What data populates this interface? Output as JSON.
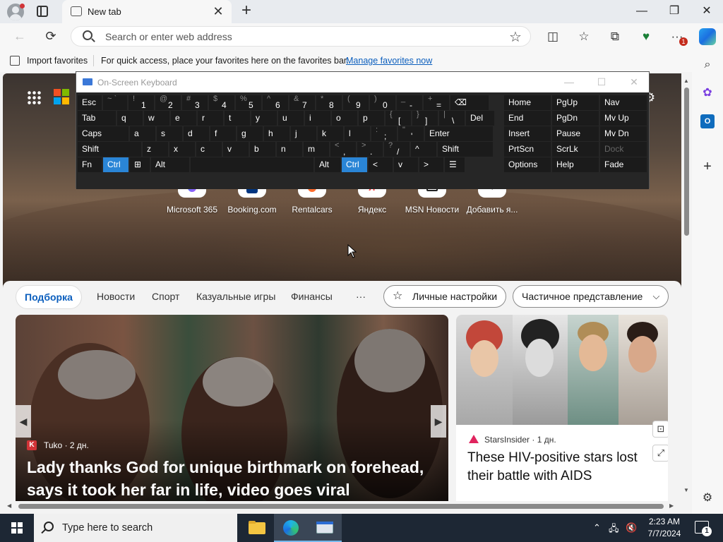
{
  "browser": {
    "tab_title": "New tab",
    "tab_close": "✕",
    "new_tab": "+",
    "window_minimize": "—",
    "window_restore": "❐",
    "window_close": "✕",
    "address_placeholder": "Search or enter web address",
    "nav_back": "←",
    "nav_refresh": "⟳",
    "fav_star": "☆",
    "notifications_badge": "1"
  },
  "favorites_bar": {
    "import_label": "Import favorites",
    "message": "For quick access, place your favorites here on the favorites bar.",
    "link": "Manage favorites now"
  },
  "sidebar_icons": [
    "search-icon",
    "copilot-icon",
    "outlook-icon",
    "add-icon",
    "settings-icon"
  ],
  "osk": {
    "title": "On-Screen Keyboard",
    "win_minimize": "—",
    "win_restore": "☐",
    "win_close": "✕",
    "rows": [
      [
        {
          "l": "Esc"
        },
        {
          "s": "~ `",
          "m": ""
        },
        {
          "s": "!",
          "m": "1"
        },
        {
          "s": "@",
          "m": "2"
        },
        {
          "s": "#",
          "m": "3"
        },
        {
          "s": "$",
          "m": "4"
        },
        {
          "s": "%",
          "m": "5"
        },
        {
          "s": "^",
          "m": "6"
        },
        {
          "s": "&",
          "m": "7"
        },
        {
          "s": "*",
          "m": "8"
        },
        {
          "s": "(",
          "m": "9"
        },
        {
          "s": ")",
          "m": "0"
        },
        {
          "s": "_",
          "m": "-"
        },
        {
          "s": "+",
          "m": "="
        },
        {
          "l": "⌫"
        }
      ],
      [
        {
          "l": "Tab"
        },
        {
          "l": "q"
        },
        {
          "l": "w"
        },
        {
          "l": "e"
        },
        {
          "l": "r"
        },
        {
          "l": "t"
        },
        {
          "l": "y"
        },
        {
          "l": "u"
        },
        {
          "l": "i"
        },
        {
          "l": "o"
        },
        {
          "l": "p"
        },
        {
          "s": "{",
          "m": "["
        },
        {
          "s": "}",
          "m": "]"
        },
        {
          "s": "|",
          "m": "\\"
        },
        {
          "l": "Del"
        }
      ],
      [
        {
          "l": "Caps"
        },
        {
          "l": "a"
        },
        {
          "l": "s"
        },
        {
          "l": "d"
        },
        {
          "l": "f"
        },
        {
          "l": "g"
        },
        {
          "l": "h"
        },
        {
          "l": "j"
        },
        {
          "l": "k"
        },
        {
          "l": "l"
        },
        {
          "s": ":",
          "m": ";"
        },
        {
          "s": "\"",
          "m": "'"
        },
        {
          "l": "Enter"
        }
      ],
      [
        {
          "l": "Shift"
        },
        {
          "l": "z"
        },
        {
          "l": "x"
        },
        {
          "l": "c"
        },
        {
          "l": "v"
        },
        {
          "l": "b"
        },
        {
          "l": "n"
        },
        {
          "l": "m"
        },
        {
          "s": "<",
          "m": ","
        },
        {
          "s": ">",
          "m": "."
        },
        {
          "s": "?",
          "m": "/"
        },
        {
          "l": "^"
        },
        {
          "l": "Shift"
        }
      ],
      [
        {
          "l": "Fn"
        },
        {
          "l": "Ctrl"
        },
        {
          "l": "⊞"
        },
        {
          "l": "Alt"
        },
        {
          "l": ""
        },
        {
          "l": "Alt"
        },
        {
          "l": "Ctrl"
        },
        {
          "l": "<"
        },
        {
          "l": "v"
        },
        {
          "l": ">"
        },
        {
          "l": "☰"
        }
      ]
    ],
    "nav_keys": [
      [
        "Home",
        "PgUp",
        "Nav"
      ],
      [
        "End",
        "PgDn",
        "Mv Up"
      ],
      [
        "Insert",
        "Pause",
        "Mv Dn"
      ],
      [
        "PrtScn",
        "ScrLk",
        "Dock"
      ],
      [
        "Options",
        "Help",
        "Fade"
      ]
    ]
  },
  "quick_links": [
    "Microsoft 365",
    "Booking.com",
    "Rentalcars",
    "Яндекс",
    "MSN Новости",
    "Добавить я..."
  ],
  "feed": {
    "tabs": [
      "Подборка",
      "Новости",
      "Спорт",
      "Казуальные игры",
      "Финансы",
      "···"
    ],
    "personalize": "Личные настройки",
    "view": "Частичное представление",
    "main_card": {
      "source": "Tuko · 2 дн.",
      "source_letter": "K",
      "title": "Lady thanks God for unique birthmark on forehead, says it took her far in life, video goes viral"
    },
    "side_card": {
      "source": "StarsInsider · 1 дн.",
      "title": "These HIV-positive stars lost their battle with AIDS"
    }
  },
  "taskbar": {
    "search_placeholder": "Type here to search",
    "time": "2:23 AM",
    "date": "7/7/2024",
    "notification_count": "1"
  }
}
